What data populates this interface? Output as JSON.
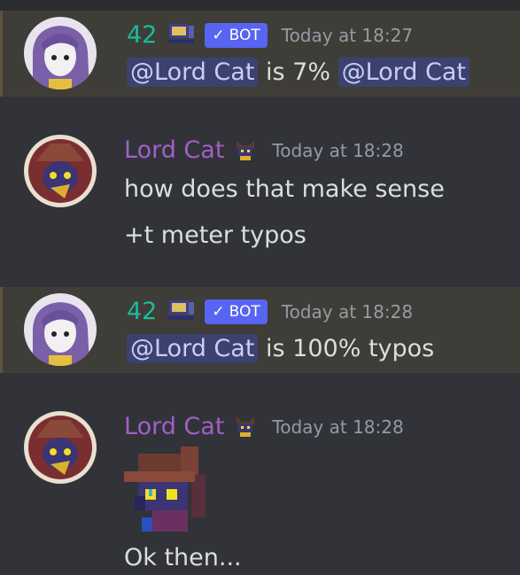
{
  "messages": [
    {
      "author": "42",
      "is_bot": true,
      "bot_badge": "BOT",
      "check": "✓",
      "time": "Today at 18:27",
      "mention1": "@Lord Cat",
      "text_mid": "is 7%",
      "mention2": "@Lord Cat"
    },
    {
      "author": "Lord Cat",
      "time": "Today at 18:28",
      "line1": "how does that make sense",
      "line2": "+t meter typos"
    },
    {
      "author": "42",
      "is_bot": true,
      "bot_badge": "BOT",
      "check": "✓",
      "time": "Today at 18:28",
      "mention1": "@Lord Cat",
      "text_end": "is 100% typos"
    },
    {
      "author": "Lord Cat",
      "time": "Today at 18:28",
      "line1": "Ok then..."
    }
  ],
  "colors": {
    "background": "#313338",
    "highlight": "#3f3d37",
    "bot_name": "#1abc9c",
    "user_name": "#a25fc7",
    "bot_badge": "#5865f2",
    "mention_bg": "#3c4270"
  },
  "icons": [
    "computer-icon",
    "cat-emoji-icon",
    "checkmark-icon"
  ]
}
